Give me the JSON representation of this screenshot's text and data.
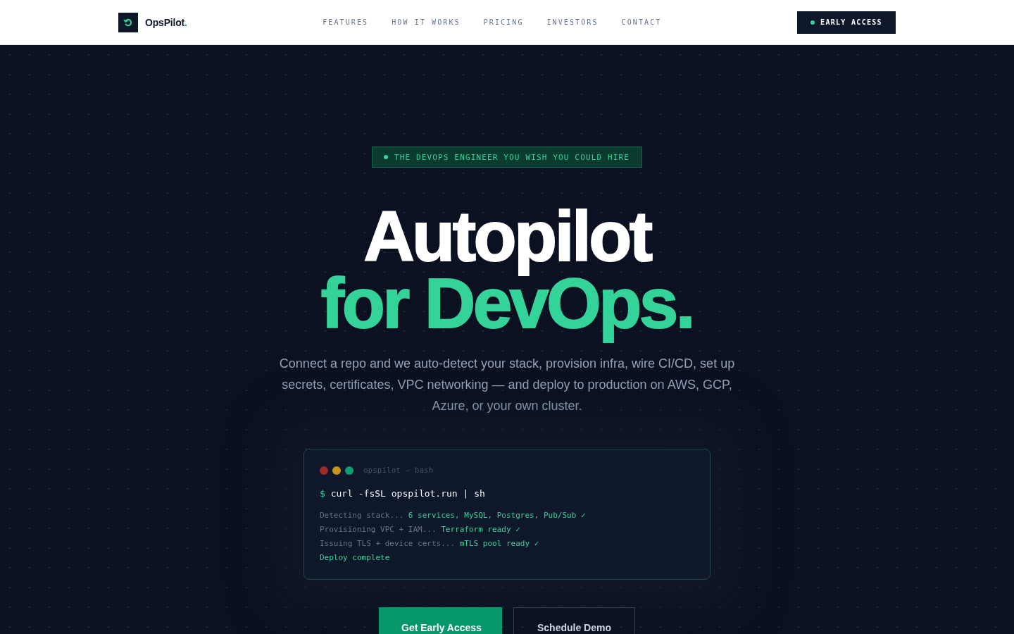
{
  "header": {
    "brand": {
      "name": "OpsPilot",
      "mark": "."
    },
    "nav": [
      {
        "label": "FEATURES"
      },
      {
        "label": "HOW IT WORKS"
      },
      {
        "label": "PRICING"
      },
      {
        "label": "INVESTORS"
      },
      {
        "label": "CONTACT"
      }
    ],
    "cta": {
      "label": "EARLY ACCESS"
    }
  },
  "hero": {
    "badge": "THE DEVOPS ENGINEER YOU WISH YOU COULD HIRE",
    "headline": [
      {
        "text": "Autopilot",
        "accent": false
      },
      {
        "text": "for DevOps.",
        "accent": true
      }
    ],
    "subtitle": "Connect a repo and we auto-detect your stack, provision infra, wire CI/CD, set up secrets, certificates, VPC networking — and deploy to production on AWS, GCP, Azure, or your own cluster.",
    "terminal": {
      "controls": [
        {
          "color": "#9b2c2c"
        },
        {
          "color": "#c4941c"
        },
        {
          "color": "#0f9f6e"
        }
      ],
      "title": "opspilot — bash",
      "prompt": "$",
      "command": "curl -fsSL opspilot.run | sh",
      "lines": [
        {
          "label": "Detecting stack...",
          "result": "6 services, MySQL, Postgres, Pub/Sub ✓"
        },
        {
          "label": "Provisioning VPC + IAM...",
          "result": "Terraform ready ✓"
        },
        {
          "label": "Issuing TLS + device certs...",
          "result": "mTLS pool ready ✓"
        },
        {
          "result": "Deploy complete"
        }
      ]
    },
    "buttons": [
      {
        "label": "Get Early Access",
        "kind": "primary"
      },
      {
        "label": "Schedule Demo",
        "kind": "secondary"
      }
    ]
  }
}
